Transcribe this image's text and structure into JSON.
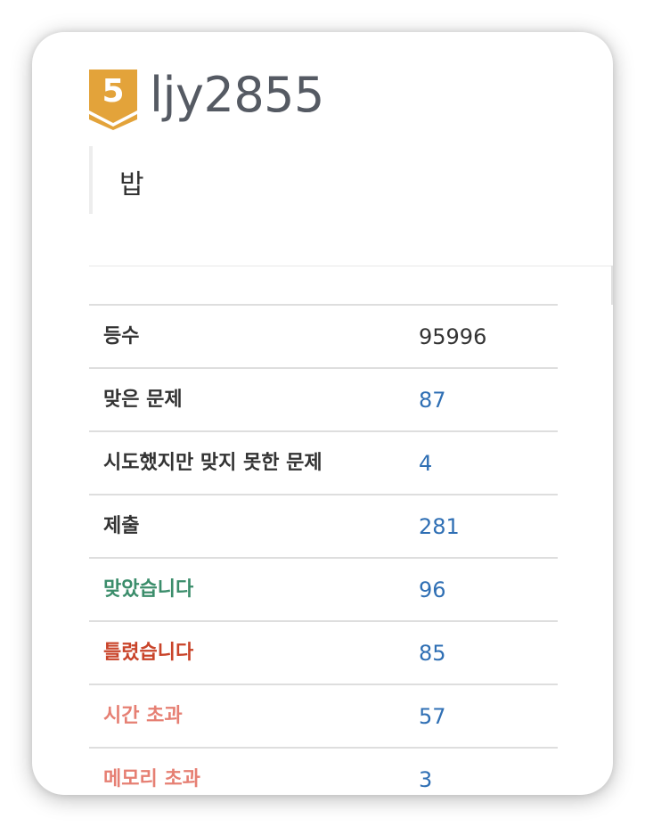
{
  "profile": {
    "tier_level": "5",
    "username": "ljy2855",
    "bio": "밥"
  },
  "colors": {
    "tier_badge": "#e3a33a",
    "tier_badge_shadow": "#c8852a",
    "link": "#2f6fb4",
    "accepted": "#3b8d6b",
    "wrong": "#c9442a",
    "time_limit": "#e67f73",
    "memory_limit": "#e67f73"
  },
  "stats": [
    {
      "label": "등수",
      "value": "95996"
    },
    {
      "label": "맞은 문제",
      "value": "87"
    },
    {
      "label": "시도했지만 맞지 못한 문제",
      "value": "4"
    },
    {
      "label": "제출",
      "value": "281"
    },
    {
      "label": "맞았습니다",
      "value": "96"
    },
    {
      "label": "틀렸습니다",
      "value": "85"
    },
    {
      "label": "시간 초과",
      "value": "57"
    },
    {
      "label": "메모리 초과",
      "value": "3"
    }
  ]
}
